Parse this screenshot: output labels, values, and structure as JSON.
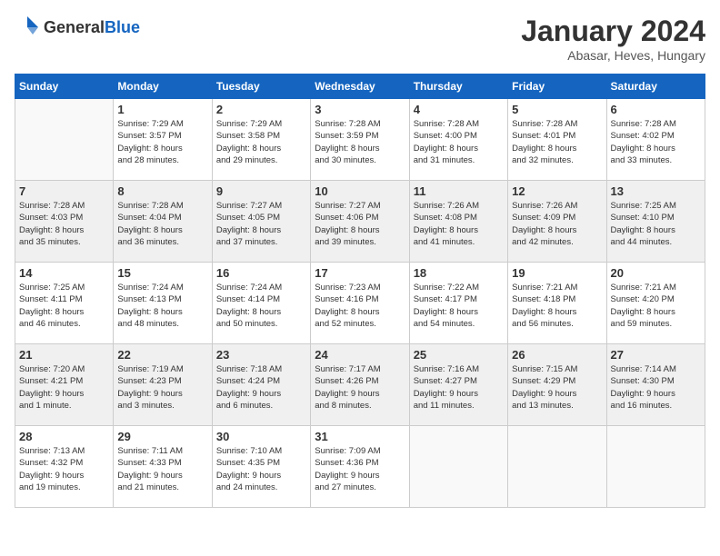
{
  "header": {
    "logo_general": "General",
    "logo_blue": "Blue",
    "title": "January 2024",
    "subtitle": "Abasar, Heves, Hungary"
  },
  "weekdays": [
    "Sunday",
    "Monday",
    "Tuesday",
    "Wednesday",
    "Thursday",
    "Friday",
    "Saturday"
  ],
  "weeks": [
    [
      {
        "day": "",
        "info": "",
        "empty": true
      },
      {
        "day": "1",
        "info": "Sunrise: 7:29 AM\nSunset: 3:57 PM\nDaylight: 8 hours\nand 28 minutes."
      },
      {
        "day": "2",
        "info": "Sunrise: 7:29 AM\nSunset: 3:58 PM\nDaylight: 8 hours\nand 29 minutes."
      },
      {
        "day": "3",
        "info": "Sunrise: 7:28 AM\nSunset: 3:59 PM\nDaylight: 8 hours\nand 30 minutes."
      },
      {
        "day": "4",
        "info": "Sunrise: 7:28 AM\nSunset: 4:00 PM\nDaylight: 8 hours\nand 31 minutes."
      },
      {
        "day": "5",
        "info": "Sunrise: 7:28 AM\nSunset: 4:01 PM\nDaylight: 8 hours\nand 32 minutes."
      },
      {
        "day": "6",
        "info": "Sunrise: 7:28 AM\nSunset: 4:02 PM\nDaylight: 8 hours\nand 33 minutes."
      }
    ],
    [
      {
        "day": "7",
        "info": "Sunrise: 7:28 AM\nSunset: 4:03 PM\nDaylight: 8 hours\nand 35 minutes.",
        "shaded": true
      },
      {
        "day": "8",
        "info": "Sunrise: 7:28 AM\nSunset: 4:04 PM\nDaylight: 8 hours\nand 36 minutes.",
        "shaded": true
      },
      {
        "day": "9",
        "info": "Sunrise: 7:27 AM\nSunset: 4:05 PM\nDaylight: 8 hours\nand 37 minutes.",
        "shaded": true
      },
      {
        "day": "10",
        "info": "Sunrise: 7:27 AM\nSunset: 4:06 PM\nDaylight: 8 hours\nand 39 minutes.",
        "shaded": true
      },
      {
        "day": "11",
        "info": "Sunrise: 7:26 AM\nSunset: 4:08 PM\nDaylight: 8 hours\nand 41 minutes.",
        "shaded": true
      },
      {
        "day": "12",
        "info": "Sunrise: 7:26 AM\nSunset: 4:09 PM\nDaylight: 8 hours\nand 42 minutes.",
        "shaded": true
      },
      {
        "day": "13",
        "info": "Sunrise: 7:25 AM\nSunset: 4:10 PM\nDaylight: 8 hours\nand 44 minutes.",
        "shaded": true
      }
    ],
    [
      {
        "day": "14",
        "info": "Sunrise: 7:25 AM\nSunset: 4:11 PM\nDaylight: 8 hours\nand 46 minutes."
      },
      {
        "day": "15",
        "info": "Sunrise: 7:24 AM\nSunset: 4:13 PM\nDaylight: 8 hours\nand 48 minutes."
      },
      {
        "day": "16",
        "info": "Sunrise: 7:24 AM\nSunset: 4:14 PM\nDaylight: 8 hours\nand 50 minutes."
      },
      {
        "day": "17",
        "info": "Sunrise: 7:23 AM\nSunset: 4:16 PM\nDaylight: 8 hours\nand 52 minutes."
      },
      {
        "day": "18",
        "info": "Sunrise: 7:22 AM\nSunset: 4:17 PM\nDaylight: 8 hours\nand 54 minutes."
      },
      {
        "day": "19",
        "info": "Sunrise: 7:21 AM\nSunset: 4:18 PM\nDaylight: 8 hours\nand 56 minutes."
      },
      {
        "day": "20",
        "info": "Sunrise: 7:21 AM\nSunset: 4:20 PM\nDaylight: 8 hours\nand 59 minutes."
      }
    ],
    [
      {
        "day": "21",
        "info": "Sunrise: 7:20 AM\nSunset: 4:21 PM\nDaylight: 9 hours\nand 1 minute.",
        "shaded": true
      },
      {
        "day": "22",
        "info": "Sunrise: 7:19 AM\nSunset: 4:23 PM\nDaylight: 9 hours\nand 3 minutes.",
        "shaded": true
      },
      {
        "day": "23",
        "info": "Sunrise: 7:18 AM\nSunset: 4:24 PM\nDaylight: 9 hours\nand 6 minutes.",
        "shaded": true
      },
      {
        "day": "24",
        "info": "Sunrise: 7:17 AM\nSunset: 4:26 PM\nDaylight: 9 hours\nand 8 minutes.",
        "shaded": true
      },
      {
        "day": "25",
        "info": "Sunrise: 7:16 AM\nSunset: 4:27 PM\nDaylight: 9 hours\nand 11 minutes.",
        "shaded": true
      },
      {
        "day": "26",
        "info": "Sunrise: 7:15 AM\nSunset: 4:29 PM\nDaylight: 9 hours\nand 13 minutes.",
        "shaded": true
      },
      {
        "day": "27",
        "info": "Sunrise: 7:14 AM\nSunset: 4:30 PM\nDaylight: 9 hours\nand 16 minutes.",
        "shaded": true
      }
    ],
    [
      {
        "day": "28",
        "info": "Sunrise: 7:13 AM\nSunset: 4:32 PM\nDaylight: 9 hours\nand 19 minutes."
      },
      {
        "day": "29",
        "info": "Sunrise: 7:11 AM\nSunset: 4:33 PM\nDaylight: 9 hours\nand 21 minutes."
      },
      {
        "day": "30",
        "info": "Sunrise: 7:10 AM\nSunset: 4:35 PM\nDaylight: 9 hours\nand 24 minutes."
      },
      {
        "day": "31",
        "info": "Sunrise: 7:09 AM\nSunset: 4:36 PM\nDaylight: 9 hours\nand 27 minutes."
      },
      {
        "day": "",
        "info": "",
        "empty": true
      },
      {
        "day": "",
        "info": "",
        "empty": true
      },
      {
        "day": "",
        "info": "",
        "empty": true
      }
    ]
  ]
}
